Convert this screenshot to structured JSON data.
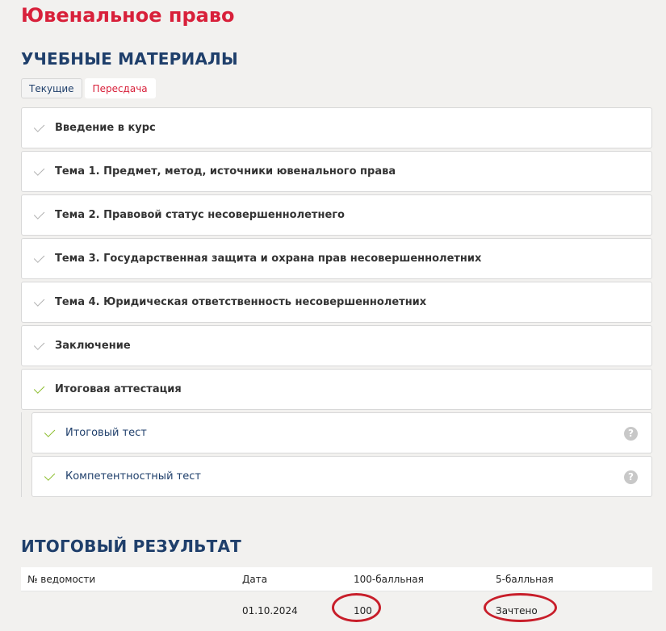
{
  "page": {
    "title": "Ювенальное право"
  },
  "materials": {
    "heading": "УЧЕБНЫЕ МАТЕРИАЛЫ",
    "tabs": [
      {
        "label": "Текущие",
        "active": false
      },
      {
        "label": "Пересдача",
        "active": true
      }
    ],
    "items": [
      {
        "label": "Введение в курс",
        "check": "check-icon"
      },
      {
        "label": "Тема 1. Предмет, метод, источники ювенального права",
        "check": "check-icon"
      },
      {
        "label": "Тема 2. Правовой статус несовершеннолетнего",
        "check": "check-icon"
      },
      {
        "label": "Тема 3. Государственная защита и охрана прав несовершеннолетних",
        "check": "check-icon"
      },
      {
        "label": "Тема 4. Юридическая ответственность несовершеннолетних",
        "check": "check-icon"
      },
      {
        "label": "Заключение",
        "check": "check-icon"
      },
      {
        "label": "Итоговая аттестация",
        "check": "check-icon"
      }
    ],
    "subitems": [
      {
        "label": "Итоговый тест",
        "help": "?"
      },
      {
        "label": "Компетентностный тест",
        "help": "?"
      }
    ]
  },
  "result": {
    "heading": "ИТОГОВЫЙ РЕЗУЛЬТАТ",
    "columns": [
      "№ ведомости",
      "Дата",
      "100-балльная",
      "5-балльная"
    ],
    "rows": [
      {
        "number": "",
        "date": "01.10.2024",
        "score100": "100",
        "score5": "Зачтено"
      }
    ]
  },
  "colors": {
    "accent_red": "#d8203a",
    "heading_blue": "#1f3f6b",
    "check_green": "#8bbd2c",
    "annotation_red": "#c81e2a"
  }
}
